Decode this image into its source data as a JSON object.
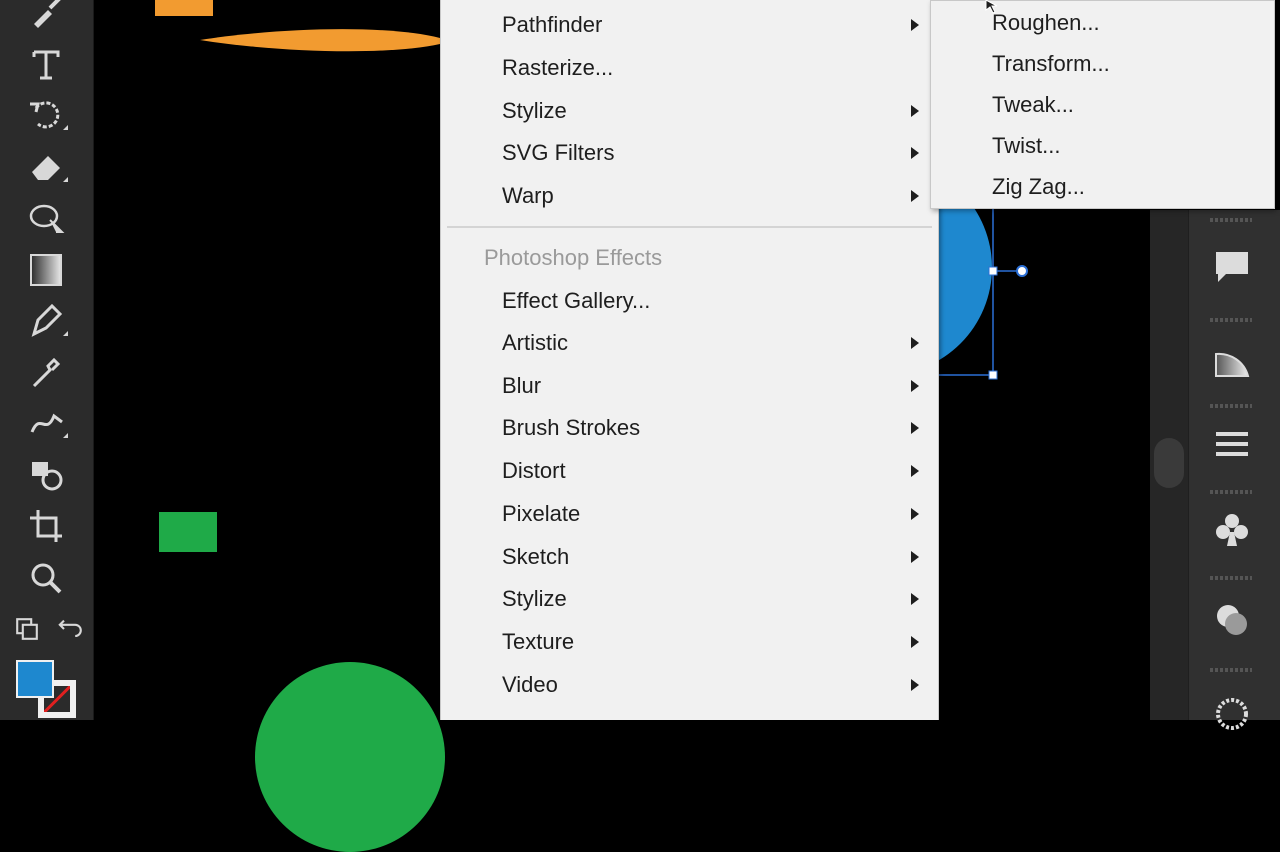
{
  "toolbar": {
    "tools": [
      "paintbrush-icon",
      "type-icon",
      "rotate-icon",
      "eraser-icon",
      "lasso-icon",
      "gradient-icon",
      "pen-icon",
      "eyedropper-icon",
      "blend-icon",
      "shape-builder-icon",
      "artboard-icon",
      "zoom-icon"
    ],
    "fill_color": "#1e88cf"
  },
  "menu": {
    "items": [
      {
        "label": "Pathfinder",
        "submenu": true
      },
      {
        "label": "Rasterize...",
        "submenu": false
      },
      {
        "label": "Stylize",
        "submenu": true
      },
      {
        "label": "SVG Filters",
        "submenu": true
      },
      {
        "label": "Warp",
        "submenu": true
      }
    ],
    "section_header": "Photoshop Effects",
    "ps_items": [
      {
        "label": "Effect Gallery...",
        "submenu": false
      },
      {
        "label": "Artistic",
        "submenu": true
      },
      {
        "label": "Blur",
        "submenu": true
      },
      {
        "label": "Brush Strokes",
        "submenu": true
      },
      {
        "label": "Distort",
        "submenu": true
      },
      {
        "label": "Pixelate",
        "submenu": true
      },
      {
        "label": "Sketch",
        "submenu": true
      },
      {
        "label": "Stylize",
        "submenu": true
      },
      {
        "label": "Texture",
        "submenu": true
      },
      {
        "label": "Video",
        "submenu": true
      }
    ]
  },
  "submenu": {
    "items": [
      "Roughen...",
      "Transform...",
      "Tweak...",
      "Twist...",
      "Zig Zag..."
    ]
  },
  "right_panel": {
    "icons": [
      "comments-icon",
      "gradient-panel-icon",
      "menu-lines-icon",
      "symbols-club-icon",
      "appearance-icon",
      "more-icon"
    ]
  },
  "colors": {
    "orange": "#f29b30",
    "green": "#1faa48",
    "blue": "#1e88cf",
    "menu_bg": "#f1f1f1"
  }
}
